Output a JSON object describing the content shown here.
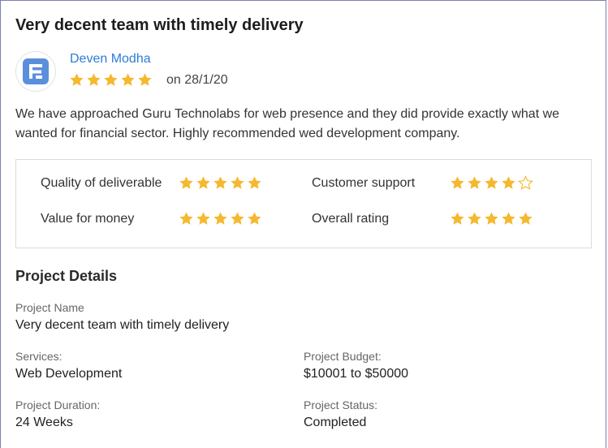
{
  "review": {
    "title": "Very decent team with timely delivery",
    "reviewer": {
      "name": "Deven Modha",
      "avatar_icon": "company-f-logo-icon",
      "avatar_color": "#5b8fdb",
      "rating": 5,
      "date": "on 28/1/20"
    },
    "text": "We have approached Guru Technolabs for web presence and they did provide exactly what we wanted for financial sector. Highly recommended wed development company."
  },
  "ratings": [
    {
      "label": "Quality of deliverable",
      "stars": 5
    },
    {
      "label": "Customer support",
      "stars": 4
    },
    {
      "label": "Value for money",
      "stars": 5
    },
    {
      "label": "Overall rating",
      "stars": 5
    }
  ],
  "project": {
    "heading": "Project Details",
    "name_label": "Project Name",
    "name_value": "Very decent team with timely delivery",
    "services_label": "Services:",
    "services_value": "Web Development",
    "budget_label": "Project Budget:",
    "budget_value": "$10001 to $50000",
    "duration_label": "Project Duration:",
    "duration_value": "24 Weeks",
    "status_label": "Project Status:",
    "status_value": "Completed"
  },
  "colors": {
    "star_filled": "#f5b82e",
    "star_empty": "#f5b82e",
    "link": "#2f7bd9"
  }
}
